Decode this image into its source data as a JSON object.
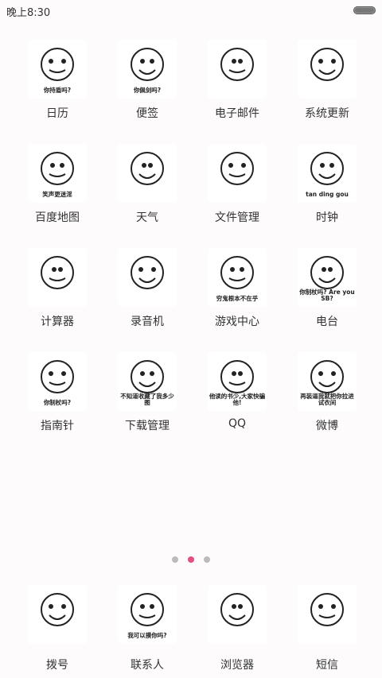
{
  "status": {
    "time": "晚上8:30"
  },
  "apps": [
    {
      "label": "日历",
      "caption": "你持盾吗?",
      "icon": "captain-shield-meme-icon"
    },
    {
      "label": "便签",
      "caption": "你佩剑吗?",
      "icon": "sword-meme-icon"
    },
    {
      "label": "电子邮件",
      "caption": "",
      "icon": "sign-meme-icon"
    },
    {
      "label": "系统更新",
      "caption": "",
      "icon": "panda-sign-meme-icon"
    },
    {
      "label": "百度地图",
      "caption": "笑声更迷淫",
      "icon": "headphone-meme-icon"
    },
    {
      "label": "天气",
      "caption": "",
      "icon": "banana-meme-icon"
    },
    {
      "label": "文件管理",
      "caption": "",
      "icon": "two-faces-meme-icon"
    },
    {
      "label": "时钟",
      "caption": "tan ding gou",
      "icon": "tentacle-meme-icon"
    },
    {
      "label": "计算器",
      "caption": "",
      "icon": "gold-meme-icon"
    },
    {
      "label": "录音机",
      "caption": "",
      "icon": "round-face-meme-icon"
    },
    {
      "label": "游戏中心",
      "caption": "穷鬼根本不在乎",
      "icon": "doraemon-meme-icon"
    },
    {
      "label": "电台",
      "caption": "你制杖吗? Are you SB?",
      "icon": "wizard-meme-icon"
    },
    {
      "label": "指南针",
      "caption": "你制杖吗?",
      "icon": "loki-meme-icon"
    },
    {
      "label": "下载管理",
      "caption": "不知道收藏了我多少图",
      "icon": "panda-sunglasses-meme-icon"
    },
    {
      "label": "QQ",
      "caption": "他读的书少,大家快骗他!",
      "icon": "laugh-meme-icon"
    },
    {
      "label": "微博",
      "caption": "再装逼我就把你拉进试衣间",
      "icon": "panda-point-meme-icon"
    }
  ],
  "pager": {
    "count": 3,
    "active": 1
  },
  "dock": [
    {
      "label": "拨号",
      "caption": "",
      "icon": "rose-face-meme-icon"
    },
    {
      "label": "联系人",
      "caption": "我可以摸你吗?",
      "icon": "rabbit-meme-icon"
    },
    {
      "label": "浏览器",
      "caption": "",
      "icon": "smug-face-meme-icon"
    },
    {
      "label": "短信",
      "caption": "",
      "icon": "soldier-panda-meme-icon"
    }
  ]
}
